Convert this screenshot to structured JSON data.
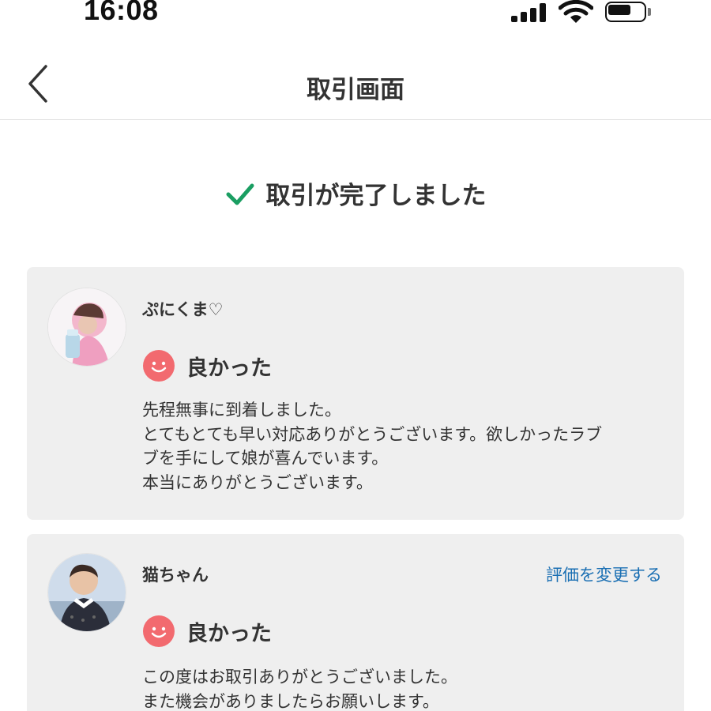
{
  "status_bar": {
    "time": "16:08"
  },
  "header": {
    "title": "取引画面"
  },
  "completion": {
    "message": "取引が完了しました",
    "icon": "check-icon",
    "icon_color": "#1a9e62"
  },
  "reviews": [
    {
      "name": "ぷにくま♡",
      "rating": "良かった",
      "rating_icon": "smile-icon",
      "rating_color": "#f26a6f",
      "comment_lines": [
        "先程無事に到着しました。",
        "とてもとても早い対応ありがとうございます。欲しかったラブ",
        "ブを手にして娘が喜んでいます。",
        "本当にありがとうございます。"
      ]
    },
    {
      "name": "猫ちゃん",
      "change_rating_label": "評価を変更する",
      "rating": "良かった",
      "rating_icon": "smile-icon",
      "rating_color": "#f26a6f",
      "comment_lines": [
        "この度はお取引ありがとうございました。",
        "また機会がありましたらお願いします。"
      ]
    }
  ],
  "colors": {
    "link": "#1a6fb3",
    "card_background": "#efefef",
    "text": "#333333"
  }
}
